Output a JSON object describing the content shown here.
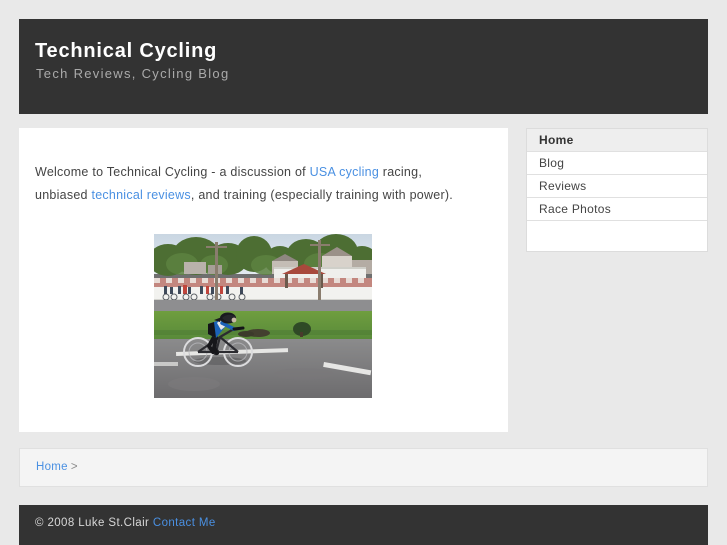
{
  "header": {
    "title": "Technical Cycling",
    "tagline": "Tech Reviews, Cycling Blog"
  },
  "main": {
    "intro": {
      "part1": "Welcome to Technical Cycling - a discussion of ",
      "link1": "USA cycling",
      "part2": " racing, unbiased ",
      "link2": "technical reviews",
      "part3": ", and training (especially training with power)."
    },
    "photo": {
      "name": "cyclist-time-trial-photo",
      "description": "Cyclist in blue and black kit riding a time trial bike on a paved road beside a grass infield, with a white track wall, trees and houses behind."
    }
  },
  "sidebar": {
    "items": [
      {
        "label": "Home",
        "active": true
      },
      {
        "label": "Blog",
        "active": false
      },
      {
        "label": "Reviews",
        "active": false
      },
      {
        "label": "Race Photos",
        "active": false
      }
    ]
  },
  "breadcrumb": {
    "home": "Home",
    "separator": ">"
  },
  "footer": {
    "copyright": "© 2008 Luke St.Clair ",
    "contact": "Contact Me"
  },
  "colors": {
    "header_bg": "#333333",
    "page_bg": "#e9e9e9",
    "content_bg": "#ffffff",
    "link": "#4a90e2",
    "body_text": "#444444",
    "tagline": "#aaaaaa",
    "breadcrumb_bg": "#f4f4f4"
  }
}
